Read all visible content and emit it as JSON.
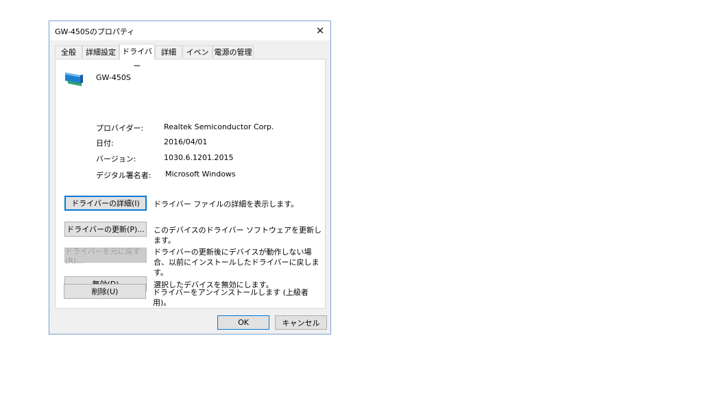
{
  "window": {
    "title": "GW-450Sのプロパティ",
    "close_glyph": "✕"
  },
  "tabs": [
    {
      "label": "全般"
    },
    {
      "label": "詳細設定"
    },
    {
      "label": "ドライバー",
      "active": true
    },
    {
      "label": "詳細"
    },
    {
      "label": "イベント"
    },
    {
      "label": "電源の管理"
    }
  ],
  "device": {
    "name": "GW-450S",
    "icon": "network-adapter-icon"
  },
  "info": [
    {
      "label": "プロバイダー:",
      "value": "Realtek Semiconductor Corp."
    },
    {
      "label": "日付:",
      "value": "2016/04/01"
    },
    {
      "label": "バージョン:",
      "value": "1030.6.1201.2015"
    },
    {
      "label": "デジタル署名者:",
      "value": "Microsoft Windows"
    }
  ],
  "actions": [
    {
      "button": "ドライバーの詳細(I)",
      "description": "ドライバー ファイルの詳細を表示します。"
    },
    {
      "button": "ドライバーの更新(P)...",
      "description": "このデバイスのドライバー ソフトウェアを更新します。"
    },
    {
      "button": "ドライバーを元に戻す(R)...",
      "description": "ドライバーの更新後にデバイスが動作しない場合、以前にインストールしたドライバーに戻します。",
      "disabled": true
    },
    {
      "button": "無効(D)",
      "description": "選択したデバイスを無効にします。"
    },
    {
      "button": "削除(U)",
      "description": "ドライバーをアンインストールします (上級者用)。"
    }
  ],
  "footer": {
    "ok_label": "OK",
    "cancel_label": "キャンセル"
  },
  "colors": {
    "accent": "#0078d7",
    "dialog_border": "#7a9fd3",
    "icon_blue": "#1e7fd0",
    "icon_green": "#2fa36b"
  }
}
